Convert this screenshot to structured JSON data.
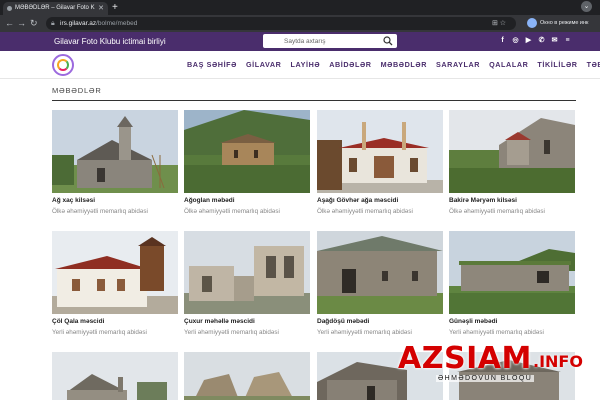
{
  "browser": {
    "tab_title": "MƏBƏDLƏR – Gilavar Foto Klubu",
    "url_domain": "irs.gilavar.az",
    "url_path": "/bolme/mebed",
    "incognito_label": "Окно в режиме инк"
  },
  "site": {
    "name": "Gilavar Foto Klubu ictimai birliyi",
    "search_placeholder": "Saytda axtarış",
    "social_icons": [
      "facebook-icon",
      "instagram-icon",
      "youtube-icon",
      "vk-icon",
      "mail-icon",
      "menu-icon"
    ]
  },
  "nav": {
    "items": [
      "BAŞ SƏHİFƏ",
      "GİLAVAR",
      "LAYİHƏ",
      "ABİDƏLƏR",
      "MƏBƏDLƏR",
      "SARAYLAR",
      "QALALAR",
      "TİKİLİLƏR",
      "TƏBİƏT"
    ]
  },
  "page": {
    "title": "MƏBƏDLƏR"
  },
  "cards": [
    {
      "name": "Ağ xaç kilsəsi",
      "desc": "Ölkə əhəmiyyətli memarlıq abidəsi"
    },
    {
      "name": "Ağoglan məbədi",
      "desc": "Ölkə əhəmiyyətli memarlıq abidəsi"
    },
    {
      "name": "Aşağı Gövhər ağa məscidi",
      "desc": "Ölkə əhəmiyyətli memarlıq abidəsi"
    },
    {
      "name": "Bakirə Məryəm kilsəsi",
      "desc": "Ölkə əhəmiyyətli memarlıq abidəsi"
    },
    {
      "name": "Çöl Qala məscidi",
      "desc": "Yerli əhəmiyyətli memarlıq abidəsi"
    },
    {
      "name": "Çuxur məhəllə məscidi",
      "desc": "Yerli əhəmiyyətli memarlıq abidəsi"
    },
    {
      "name": "Dağdöşü məbədi",
      "desc": "Yerli əhəmiyyətli memarlıq abidəsi"
    },
    {
      "name": "Günəşli məbədi",
      "desc": "Yerli əhəmiyyətli memarlıq abidəsi"
    }
  ],
  "watermark": {
    "main": "AZSIAM",
    "suffix": ".INFO",
    "sub": "ƏHMƏDOVUN BLOQU"
  }
}
